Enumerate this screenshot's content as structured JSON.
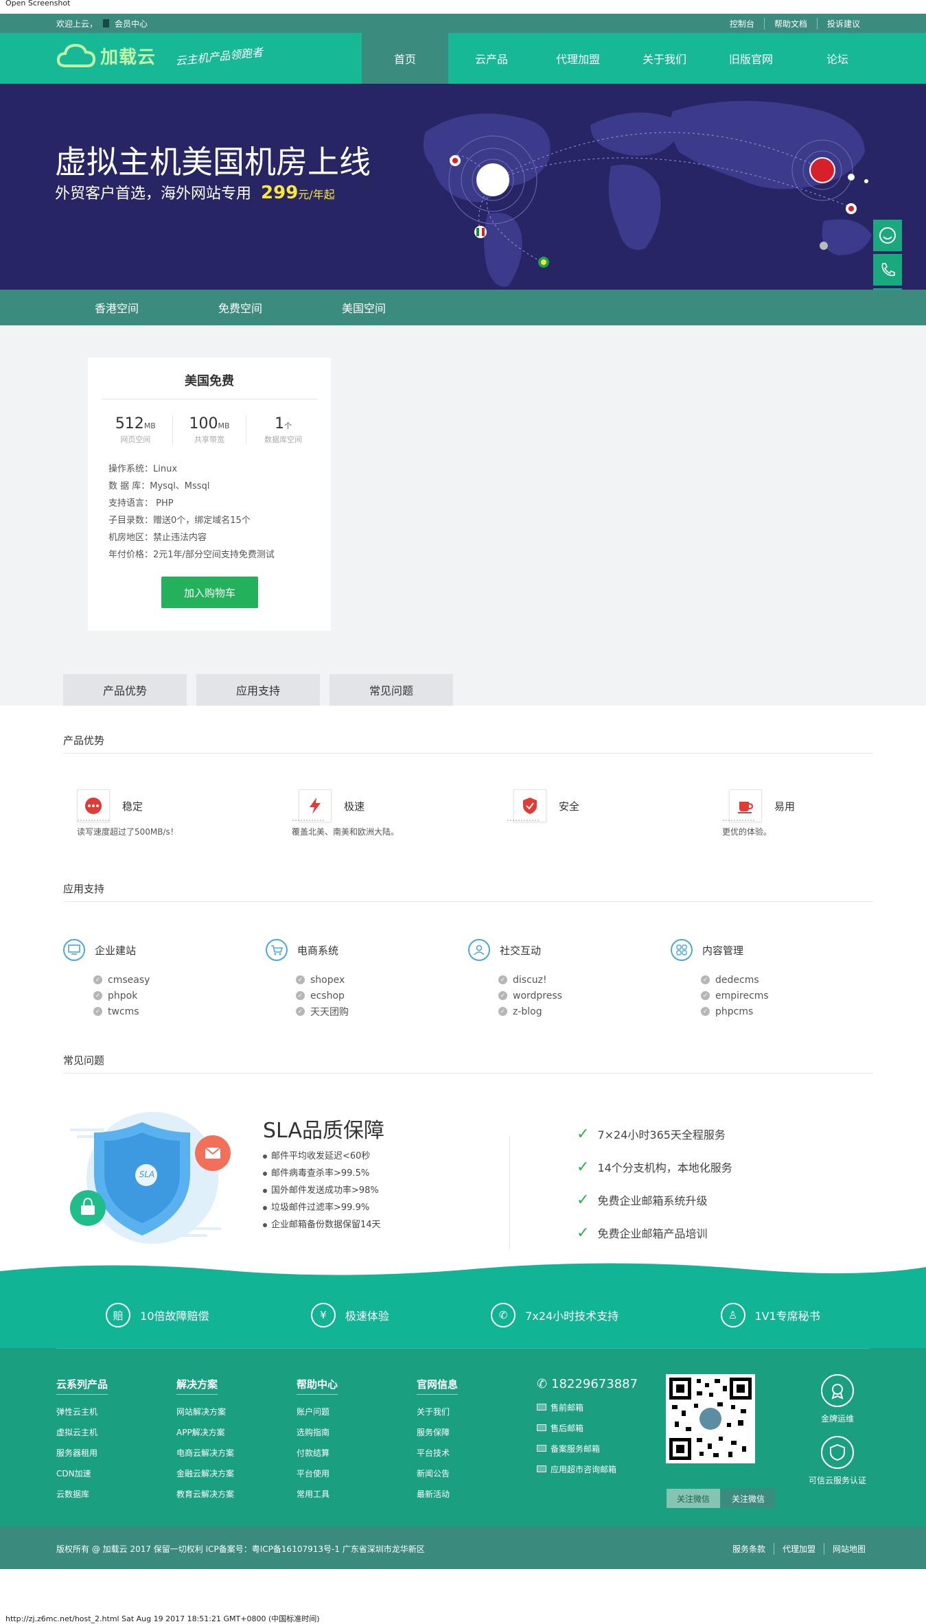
{
  "screenshot_label": "Open Screenshot",
  "topbar": {
    "welcome": "欢迎上云，",
    "member": "会员中心",
    "links": [
      "控制台",
      "帮助文档",
      "投诉建议"
    ]
  },
  "header": {
    "brand": "加载云",
    "slogan": "云主机产品领跑者",
    "nav": [
      "首页",
      "云产品",
      "代理加盟",
      "关于我们",
      "旧版官网",
      "论坛"
    ]
  },
  "banner": {
    "title": "虚拟主机美国机房上线",
    "subtitle": "外贸客户首选，海外网站专用",
    "price": "299",
    "price_unit": "元/年起"
  },
  "subnav": [
    "香港空间",
    "免费空间",
    "美国空间"
  ],
  "card": {
    "title": "美国免费",
    "specs": [
      {
        "value": "512",
        "unit": "MB",
        "label": "网页空间"
      },
      {
        "value": "100",
        "unit": "MB",
        "label": "共享带宽"
      },
      {
        "value": "1",
        "unit": "个",
        "label": "数据库空间"
      }
    ],
    "info": [
      "操作系统：Linux",
      "数 据 库：Mysql、Mssql",
      "支持语言： PHP",
      "子目录数：赠送0个，绑定域名15个",
      "机房地区：禁止违法内容",
      "年付价格：2元1年/部分空间支持免费测试"
    ],
    "button": "加入购物车"
  },
  "tabs": [
    "产品优势",
    "应用支持",
    "常见问题"
  ],
  "advantages": {
    "title": "产品优势",
    "items": [
      {
        "label": "稳定",
        "desc_line1": "…………",
        "desc_line2": "读写速度超过了500MB/s！"
      },
      {
        "label": "极速",
        "desc_line1": "…………",
        "desc_line2": "覆盖北美、南美和欧洲大陆。"
      },
      {
        "label": "安全",
        "desc_line1": "…………",
        "desc_line2": ""
      },
      {
        "label": "易用",
        "desc_line1": "…………",
        "desc_line2": "更优的体验。"
      }
    ]
  },
  "apps": {
    "title": "应用支持",
    "cols": [
      {
        "title": "企业建站",
        "items": [
          "cmseasy",
          "phpok",
          "twcms"
        ]
      },
      {
        "title": "电商系统",
        "items": [
          "shopex",
          "ecshop",
          "天天团购"
        ]
      },
      {
        "title": "社交互动",
        "items": [
          "discuz!",
          "wordpress",
          "z-blog"
        ]
      },
      {
        "title": "内容管理",
        "items": [
          "dedecms",
          "empirecms",
          "phpcms"
        ]
      }
    ]
  },
  "faq": {
    "title": "常见问题",
    "sla_badge": "SLA",
    "sla_title": "SLA品质保障",
    "sla_items": [
      "邮件平均收发延迟<60秒",
      "邮件病毒查杀率>99.5%",
      "国外邮件发送成功率>98%",
      "垃圾邮件过滤率>99.9%",
      "企业邮箱备份数据保留14天"
    ],
    "promises": [
      "7×24小时365天全程服务",
      "14个分支机构，本地化服务",
      "免费企业邮箱系统升级",
      "免费企业邮箱产品培训"
    ]
  },
  "features": [
    {
      "icon_text": "赔",
      "label": "10倍故障赔偿"
    },
    {
      "icon_text": "¥",
      "label": "极速体验"
    },
    {
      "icon_text": "✆",
      "label": "7x24小时技术支持"
    },
    {
      "icon_text": "♙",
      "label": "1V1专席秘书"
    }
  ],
  "footer": {
    "cols": [
      {
        "title": "云系列产品",
        "items": [
          "弹性云主机",
          "虚拟云主机",
          "服务器租用",
          "CDN加速",
          "云数据库"
        ]
      },
      {
        "title": "解决方案",
        "items": [
          "网站解决方案",
          "APP解决方案",
          "电商云解决方案",
          "金融云解决方案",
          "教育云解决方案"
        ]
      },
      {
        "title": "帮助中心",
        "items": [
          "账户问题",
          "选购指南",
          "付款结算",
          "平台使用",
          "常用工具"
        ]
      },
      {
        "title": "官网信息",
        "items": [
          "关于我们",
          "服务保障",
          "平台技术",
          "新闻公告",
          "最新活动"
        ]
      }
    ],
    "phone": "18229673887",
    "mails": [
      "售前邮箱",
      "售后邮箱",
      "备案服务邮箱",
      "应用超市咨询邮箱"
    ],
    "qr_buttons": [
      "关注微信",
      "关注微信"
    ],
    "badges": [
      "金牌运维",
      "可信云服务认证"
    ]
  },
  "copyright": {
    "text": "版权所有 @ 加载云 2017   保留一切权利   ICP备案号：粤ICP备16107913号-1   广东省深圳市龙华新区",
    "links": [
      "服务条款",
      "代理加盟",
      "网站地图"
    ]
  },
  "status_bar": "http://zj.z6mc.net/host_2.html Sat Aug 19 2017 18:51:21 GMT+0800 (中国标准时间)"
}
